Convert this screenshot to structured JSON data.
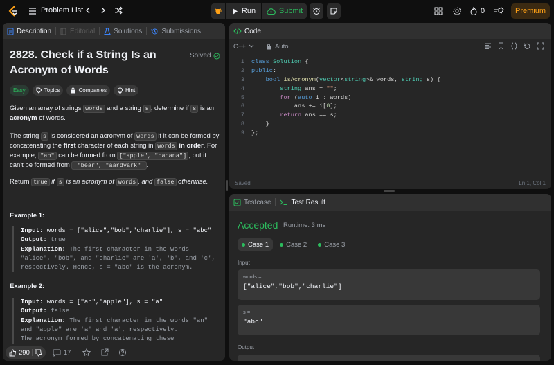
{
  "topbar": {
    "problem_list": "Problem List",
    "run": "Run",
    "submit": "Submit",
    "streak_count": "0",
    "premium": "Premium"
  },
  "description": {
    "tabs": [
      "Description",
      "Editorial",
      "Solutions",
      "Submissions"
    ],
    "title": "2828. Check if a String Is an Acronym of Words",
    "solved": "Solved",
    "chips": [
      "Easy",
      "Topics",
      "Companies",
      "Hint"
    ],
    "p1": {
      "a": "Given an array of strings ",
      "b": "words",
      "c": " and a string ",
      "d": "s",
      "e": ", determine if ",
      "f": "s",
      "g": " is an ",
      "h": "acronym",
      "i": " of words."
    },
    "p2": {
      "a": "The string ",
      "b": "s",
      "c": " is considered an acronym of ",
      "d": "words",
      "e": " if it can be formed by concatenating the ",
      "f": "first",
      "g": " character of each string in ",
      "h": "words",
      "i": " ",
      "j": "in order",
      "k": ". For example, ",
      "l": "\"ab\"",
      "m": " can be formed from ",
      "n": "[\"apple\", \"banana\"]",
      "o": ", but it can't be formed from ",
      "p": "[\"bear\", \"aardvark\"]",
      "q": "."
    },
    "p3": {
      "a": "Return ",
      "b": "true",
      "c": " if ",
      "d": "s",
      "e": " is an acronym of ",
      "f": "words",
      "g": ", and ",
      "h": "false",
      "i": " otherwise."
    },
    "example1": {
      "heading": "Example 1:",
      "input_label": "Input:",
      "input": " words = [\"alice\",\"bob\",\"charlie\"], s = \"abc\"",
      "output_label": "Output:",
      "output": " true",
      "expl_label": "Explanation:",
      "expl": " The first character in the words \"alice\", \"bob\", and \"charlie\" are 'a', 'b', and 'c', respectively. Hence, s = \"abc\" is the acronym."
    },
    "example2": {
      "heading": "Example 2:",
      "input_label": "Input:",
      "input": " words = [\"an\",\"apple\"], s = \"a\"",
      "output_label": "Output:",
      "output": " false",
      "expl_label": "Explanation:",
      "expl": " The first character in the words \"an\" and \"apple\" are 'a' and 'a', respectively.",
      "expl2": "The acronym formed by concatenating these"
    },
    "likes": "290",
    "comments": "17"
  },
  "code": {
    "tab": "Code",
    "language": "C++",
    "mode": "Auto",
    "status_left": "Saved",
    "status_right": "Ln 1, Col 1",
    "line_numbers": [
      "1",
      "2",
      "3",
      "4",
      "5",
      "6",
      "7",
      "8",
      "9"
    ]
  },
  "test": {
    "tabs": [
      "Testcase",
      "Test Result"
    ],
    "verdict": "Accepted",
    "runtime": "Runtime: 3 ms",
    "cases": [
      "Case 1",
      "Case 2",
      "Case 3"
    ],
    "input_label": "Input",
    "var1_name": "words =",
    "var1_value": "[\"alice\",\"bob\",\"charlie\"]",
    "var2_name": "s =",
    "var2_value": "\"abc\"",
    "output_label": "Output"
  },
  "colors": {
    "accent_green": "#2cbb5d",
    "premium": "#ffa116",
    "panel": "#262626"
  }
}
